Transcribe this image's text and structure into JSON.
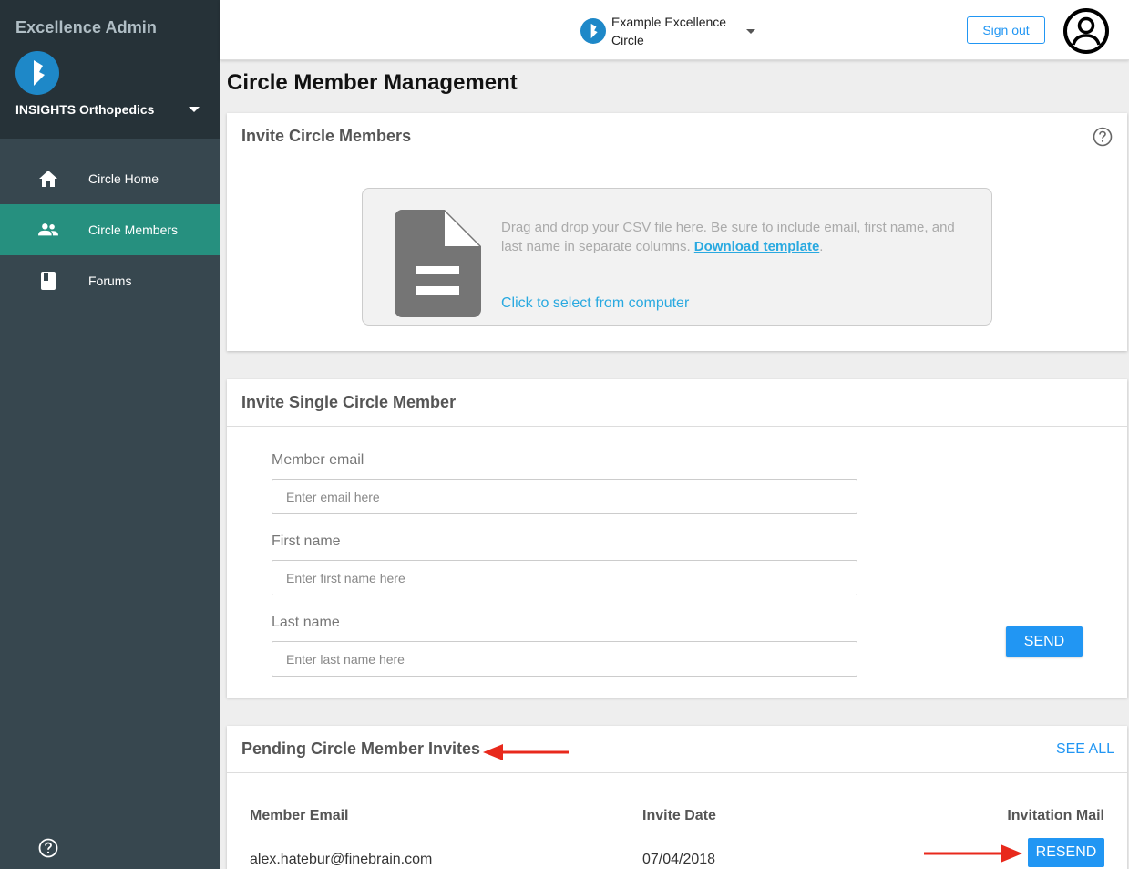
{
  "sidebar": {
    "app_title": "Excellence Admin",
    "org_name": "INSIGHTS Orthopedics",
    "items": [
      {
        "label": "Circle Home",
        "icon": "home-icon"
      },
      {
        "label": "Circle Members",
        "icon": "people-icon",
        "active": true
      },
      {
        "label": "Forums",
        "icon": "book-icon"
      }
    ],
    "help_icon": "help-icon"
  },
  "topbar": {
    "circle_name": "Example Excellence Circle",
    "signout_label": "Sign out",
    "avatar_icon": "account-circle-icon"
  },
  "page": {
    "title": "Circle Member Management"
  },
  "invite_bulk": {
    "title": "Invite Circle Members",
    "drop_text": "Drag and drop your CSV file here. Be sure to include email, first name, and last name in separate columns.",
    "download_link": "Download template",
    "drop_suffix": ".",
    "select_label": "Click to select from computer"
  },
  "invite_single": {
    "title": "Invite Single Circle Member",
    "email_label": "Member email",
    "email_placeholder": "Enter email here",
    "first_label": "First name",
    "first_placeholder": "Enter first name here",
    "last_label": "Last name",
    "last_placeholder": "Enter last name here",
    "send_label": "SEND"
  },
  "pending": {
    "title": "Pending Circle Member Invites",
    "see_all_label": "SEE ALL",
    "columns": [
      "Member Email",
      "Invite Date",
      "Invitation Mail"
    ],
    "rows": [
      {
        "email": "alex.hatebur@finebrain.com",
        "date": "07/04/2018",
        "action": "RESEND"
      }
    ]
  },
  "colors": {
    "accent": "#2196f3",
    "active_nav": "#26907f",
    "sidebar_bg": "#37474f",
    "annotation_arrow": "#e8291c"
  }
}
